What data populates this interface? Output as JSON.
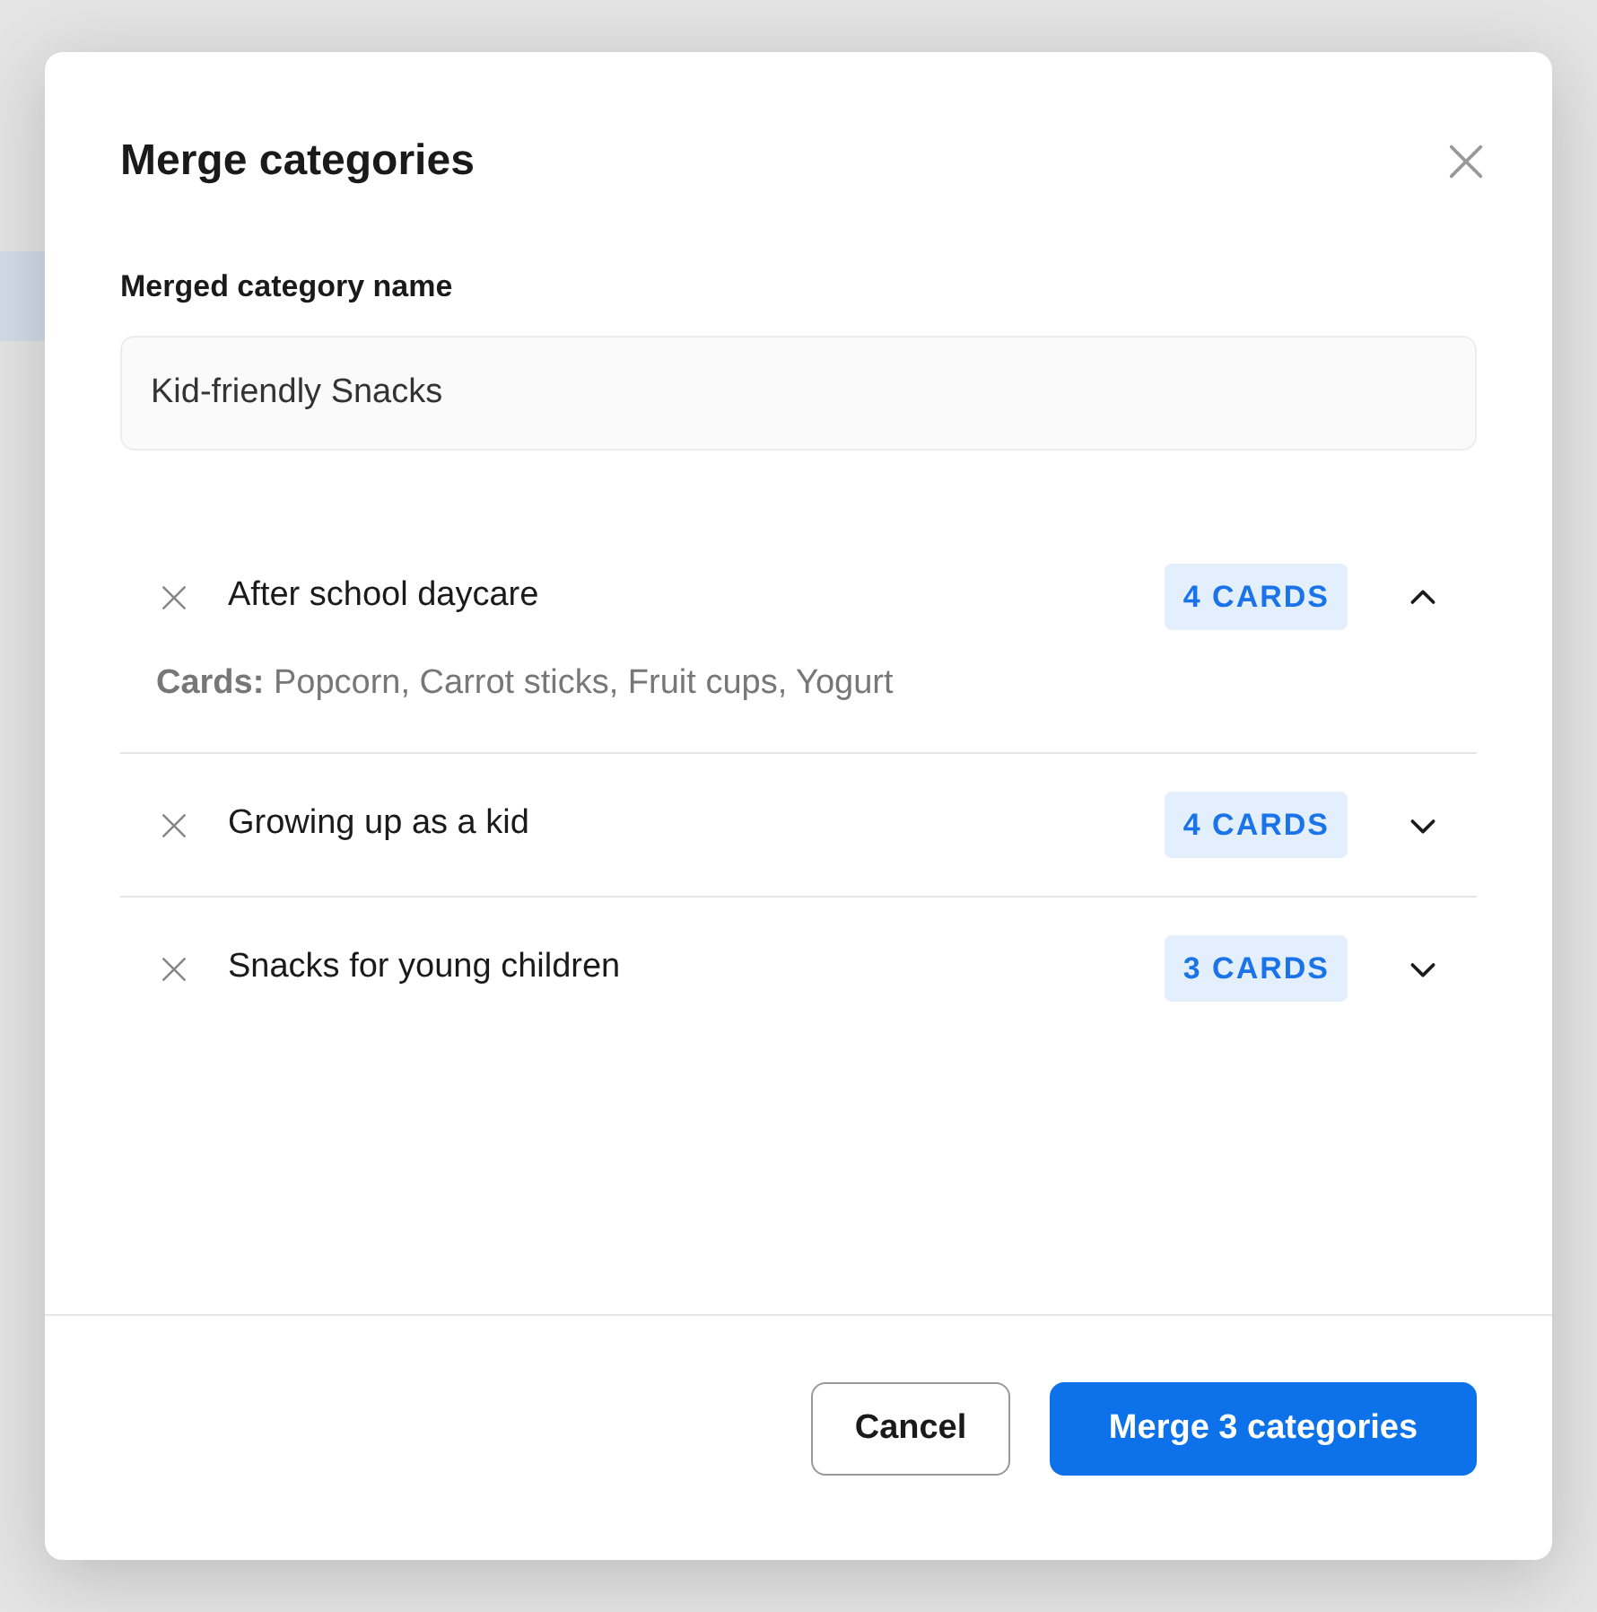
{
  "dialog": {
    "title": "Merge categories",
    "name_label": "Merged category name",
    "name_value": "Kid-friendly Snacks",
    "categories": [
      {
        "name": "After school daycare",
        "count": "4 CARDS",
        "expanded": true,
        "cards_label": "Cards:",
        "cards": "Popcorn, Carrot sticks, Fruit cups, Yogurt"
      },
      {
        "name": "Growing up as a kid",
        "count": "4 CARDS",
        "expanded": false
      },
      {
        "name": "Snacks for young children",
        "count": "3 CARDS",
        "expanded": false
      }
    ],
    "buttons": {
      "cancel": "Cancel",
      "confirm": "Merge 3 categories"
    }
  }
}
